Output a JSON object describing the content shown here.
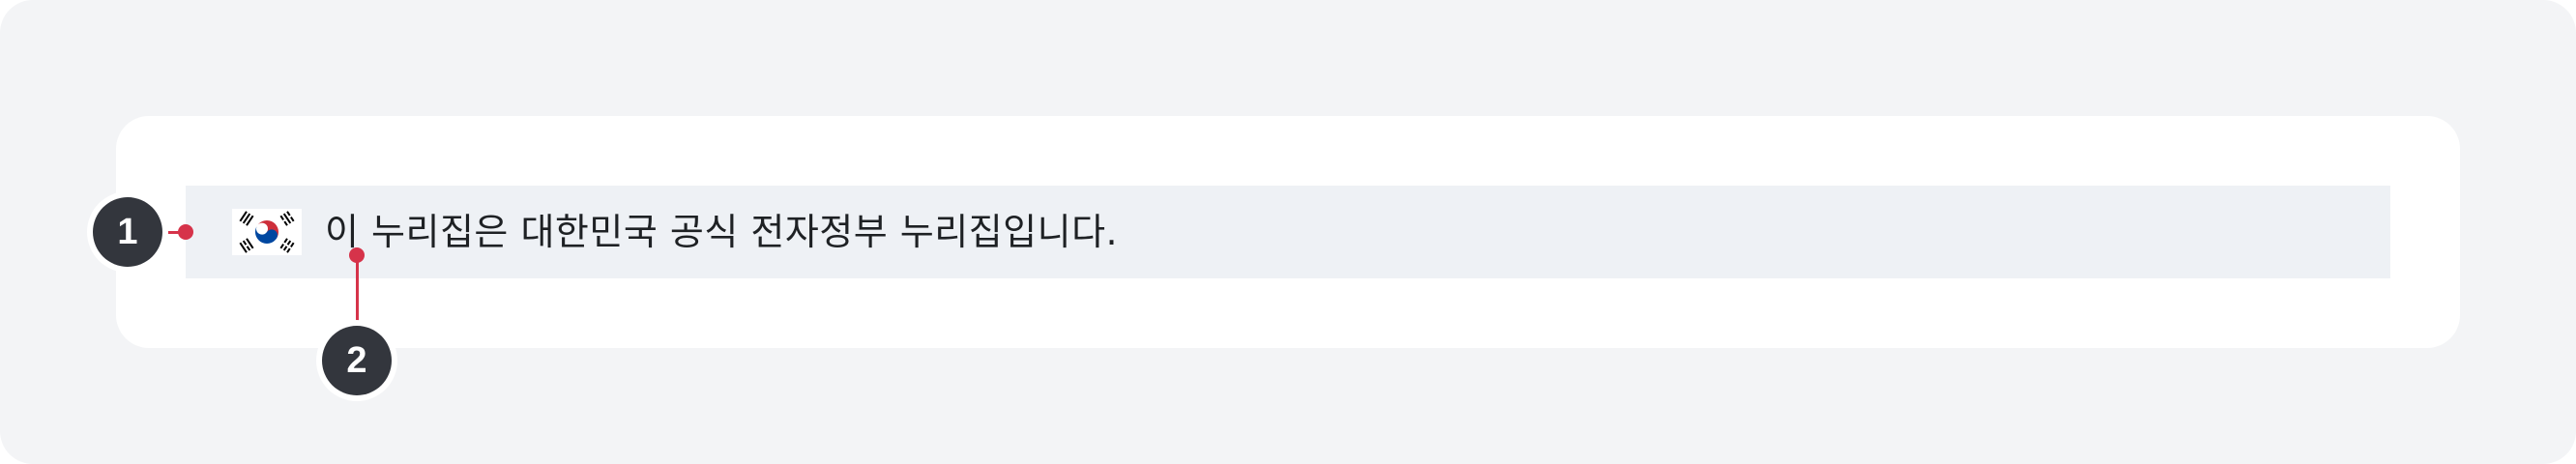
{
  "banner": {
    "text": "이 누리집은 대한민국 공식 전자정부 누리집입니다.",
    "flag_icon": "korean-flag-icon"
  },
  "annotations": {
    "marker_1": "1",
    "marker_2": "2"
  },
  "colors": {
    "background": "#f3f4f6",
    "card": "#ffffff",
    "banner": "#eef1f5",
    "text": "#1e2124",
    "marker": "#33363d",
    "connector": "#d6334a",
    "flag_red": "#cd2e3a",
    "flag_blue": "#0047a0"
  }
}
